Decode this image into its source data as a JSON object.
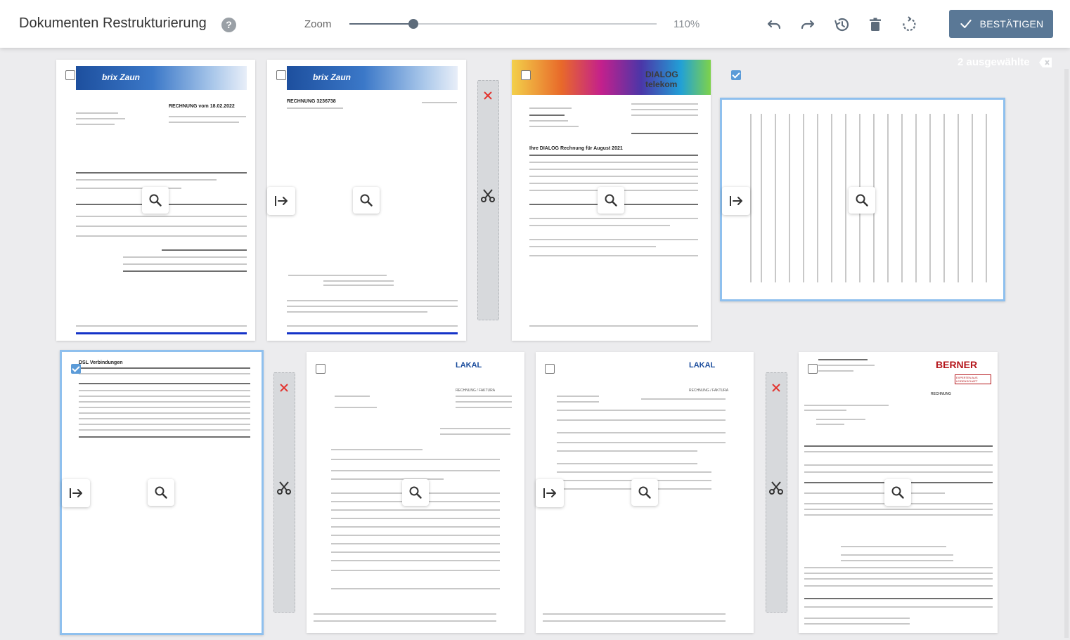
{
  "toolbar": {
    "title": "Dokumenten Restrukturierung",
    "help_icon": "?",
    "zoom_label": "Zoom",
    "zoom_value": "110%",
    "zoom_slider_position": 0.21,
    "confirm_label": "BESTÄTIGEN",
    "accent_color": "#5a7896"
  },
  "selection": {
    "count_label": "2 ausgewählte"
  },
  "pages": [
    {
      "name": "brix-zaun-rechnung-page-1",
      "heading": "RECHNUNG vom 18.02.2022",
      "selected": false
    },
    {
      "name": "brix-zaun-rechnung-page-2",
      "heading": "RECHNUNG 3236738",
      "selected": false
    },
    {
      "name": "dialog-telekom-rechnung",
      "heading": "Ihre DIALOG Rechnung für August 2021",
      "selected": false
    },
    {
      "name": "dialog-rotated-page",
      "heading": "",
      "selected": true
    },
    {
      "name": "dialog-verbindungen-page",
      "heading": "DSL Verbindungen",
      "selected": true
    },
    {
      "name": "lakal-faktura-1",
      "heading": "RECHNUNG / FAKTURA",
      "selected": false
    },
    {
      "name": "lakal-faktura-2",
      "heading": "RECHNUNG / FAKTURA",
      "selected": false
    },
    {
      "name": "berner-rechnung",
      "heading": "RECHNUNG",
      "selected": false
    }
  ],
  "doc_text": {
    "brix_logo": "brix Zaun",
    "dialog_logo": "DIALOG telekom",
    "lakal_logo": "LAKAL",
    "berner_logo": "BERNER",
    "berner_tag": "EXPERTEN AUS LEIDENSCHAFT"
  }
}
